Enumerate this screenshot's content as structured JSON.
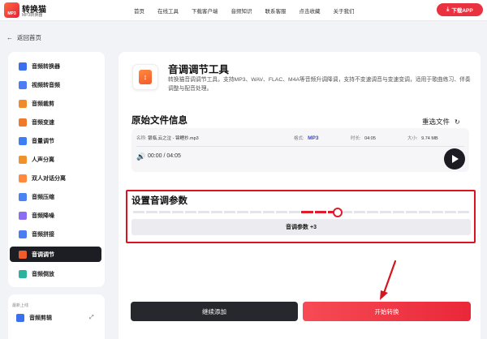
{
  "header": {
    "logo_title": "转换猫",
    "logo_sub": "MP3转换器",
    "logo_badge": "MP3",
    "nav": [
      "首页",
      "在线工具",
      "下载客户端",
      "音频知识",
      "联系客服",
      "点击收藏",
      "关于我们"
    ],
    "download_label": "下载APP"
  },
  "back_label": "返回首页",
  "sidebar": {
    "items": [
      {
        "label": "音频转换器",
        "color": "#3a6ff0"
      },
      {
        "label": "视频转音频",
        "color": "#4a7cf3"
      },
      {
        "label": "音频裁剪",
        "color": "#f08a2b"
      },
      {
        "label": "音频变速",
        "color": "#f07a2b"
      },
      {
        "label": "音量调节",
        "color": "#3b7ef5"
      },
      {
        "label": "人声分离",
        "color": "#f0922b"
      },
      {
        "label": "双人对话分离",
        "color": "#ff8a3d"
      },
      {
        "label": "音频压缩",
        "color": "#4b82f2"
      },
      {
        "label": "音频降噪",
        "color": "#8a6df2"
      },
      {
        "label": "音频拼接",
        "color": "#4a7cf3"
      },
      {
        "label": "音调调节",
        "color": "#f25b2a"
      },
      {
        "label": "音频倒放",
        "color": "#2bb3a0"
      }
    ],
    "section_label": "最新上线",
    "new_item": "音频剪辑"
  },
  "tool": {
    "title": "音调调节工具",
    "icon_glyph": "↕",
    "description": "转换猫音调调节工具，支持MP3、WAV、FLAC、M4A等音频升调降调，支持不变速调音与变速变调，适用于歌曲练习、伴奏调整与配音处理。"
  },
  "file_section": {
    "title": "原始文件信息",
    "reselect_label": "重选文件",
    "name_label": "名称:",
    "name_value": "银临,云之泣 - 锦鲤抄.mp3",
    "format_label": "格式:",
    "format_value": "MP3",
    "duration_label": "时长:",
    "duration_value": "04:05",
    "size_label": "大小:",
    "size_value": "9.74 MB",
    "player_time": "00:00 / 04:05"
  },
  "param_section": {
    "title": "设置音调参数",
    "button_label": "音调参数 +3",
    "slider_level": 0.62
  },
  "actions": {
    "add_label": "继续添加",
    "start_label": "开始转换"
  },
  "colors": {
    "accent": "#ea3140",
    "dark": "#1d1d24",
    "highlight_border": "#d9141f"
  }
}
